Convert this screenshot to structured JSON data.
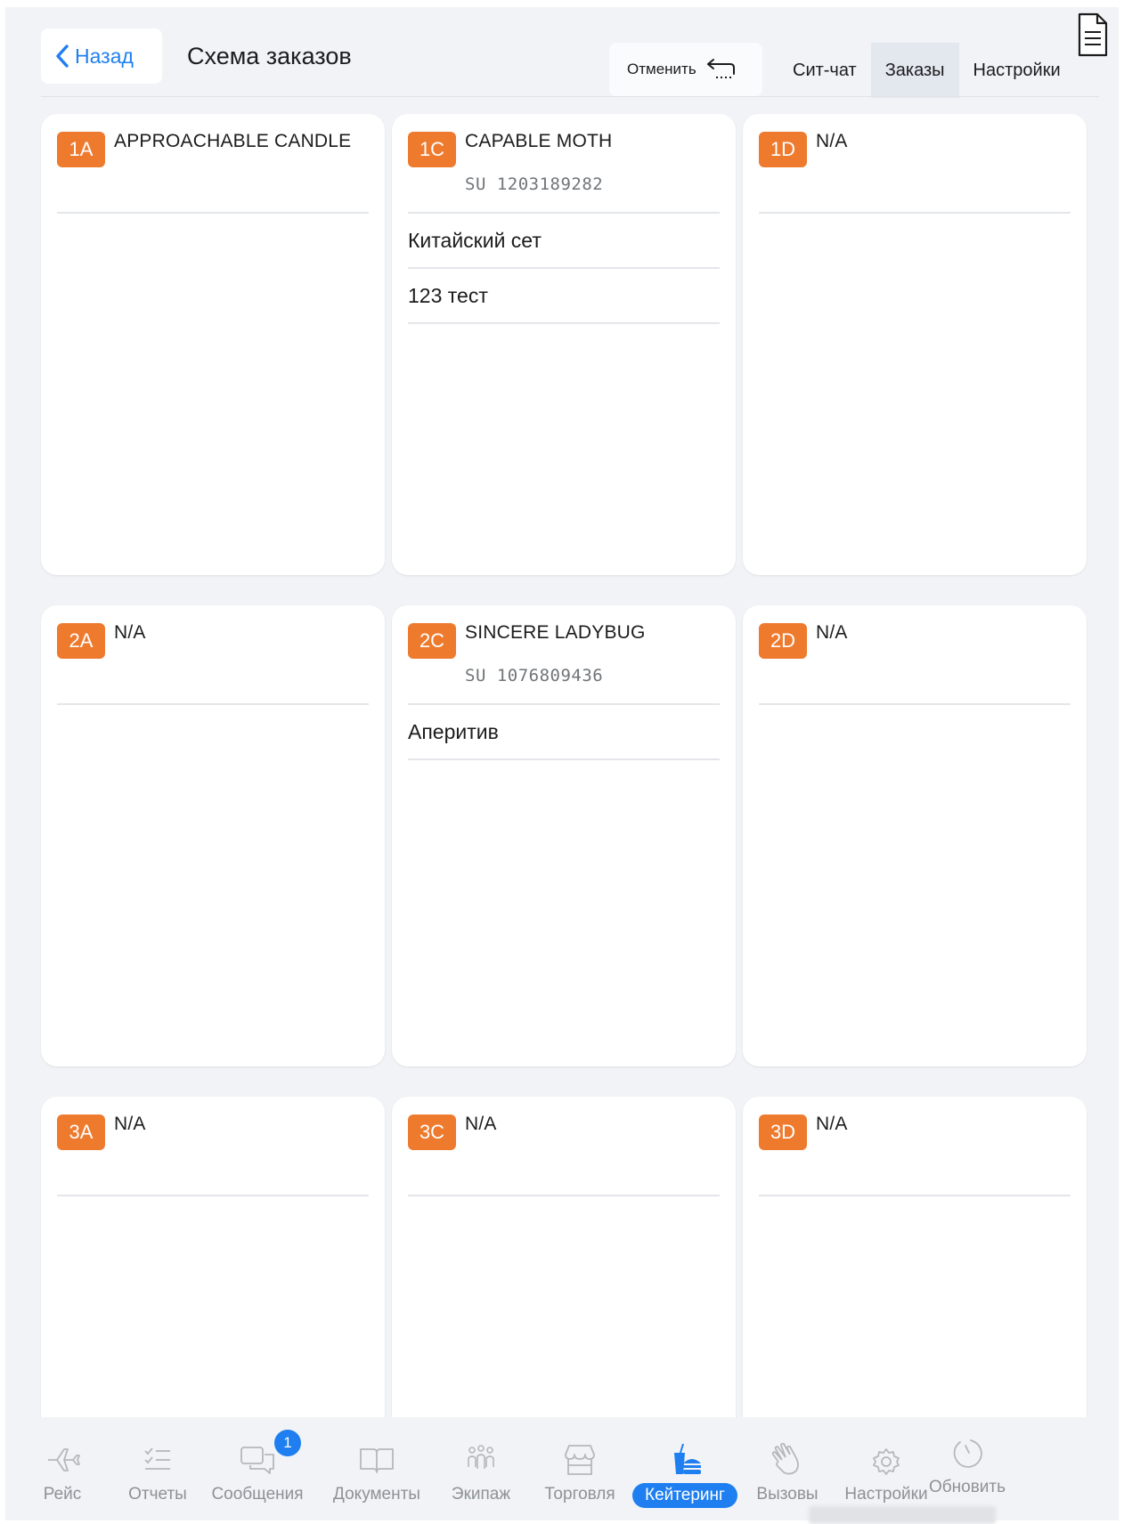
{
  "header": {
    "back_label": "Назад",
    "title": "Схема заказов",
    "undo_label": "Отменить",
    "tabs": [
      {
        "label": "Сит-чат",
        "active": false
      },
      {
        "label": "Заказы",
        "active": true
      },
      {
        "label": "Настройки",
        "active": false
      }
    ]
  },
  "seats": [
    {
      "seat": "1A",
      "name": "APPROACHABLE CANDLE",
      "id": "",
      "orders": []
    },
    {
      "seat": "1C",
      "name": "CAPABLE MOTH",
      "id": "SU 1203189282",
      "orders": [
        "Китайский сет",
        "123 тест"
      ]
    },
    {
      "seat": "1D",
      "name": "N/A",
      "id": "",
      "orders": []
    },
    {
      "seat": "2A",
      "name": "N/A",
      "id": "",
      "orders": []
    },
    {
      "seat": "2C",
      "name": "SINCERE LADYBUG",
      "id": "SU 1076809436",
      "orders": [
        "Аперитив"
      ]
    },
    {
      "seat": "2D",
      "name": "N/A",
      "id": "",
      "orders": []
    },
    {
      "seat": "3A",
      "name": "N/A",
      "id": "",
      "orders": []
    },
    {
      "seat": "3C",
      "name": "N/A",
      "id": "",
      "orders": []
    },
    {
      "seat": "3D",
      "name": "N/A",
      "id": "",
      "orders": []
    }
  ],
  "tabbar": {
    "items": [
      {
        "label": "Рейс",
        "icon": "plane-icon",
        "active": false
      },
      {
        "label": "Отчеты",
        "icon": "checklist-icon",
        "active": false
      },
      {
        "label": "Сообщения",
        "icon": "chat-icon",
        "active": false,
        "badge": "1"
      },
      {
        "label": "Документы",
        "icon": "book-icon",
        "active": false
      },
      {
        "label": "Экипаж",
        "icon": "crew-icon",
        "active": false
      },
      {
        "label": "Торговля",
        "icon": "store-icon",
        "active": false
      },
      {
        "label": "Кейтеринг",
        "icon": "catering-icon",
        "active": true
      },
      {
        "label": "Вызовы",
        "icon": "wave-hand-icon",
        "active": false
      },
      {
        "label": "Настройки",
        "icon": "gear-icon",
        "active": false
      },
      {
        "label": "Обновить",
        "icon": "refresh-icon",
        "active": false
      }
    ]
  },
  "colors": {
    "accent": "#1f7ff0",
    "seat_badge": "#ee7a2e",
    "background": "#f1f3f6"
  }
}
